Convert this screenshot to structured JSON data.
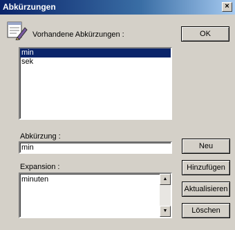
{
  "window": {
    "title": "Abkürzungen",
    "close_glyph": "×"
  },
  "labels": {
    "existing": "Vorhandene Abkürzungen :",
    "abbr": "Abkürzung :",
    "expansion": "Expansion :"
  },
  "list": {
    "items": [
      "min",
      "sek"
    ],
    "selected": "min"
  },
  "abbr_field": {
    "value": "min"
  },
  "expansion_field": {
    "value": "minuten"
  },
  "buttons": {
    "ok": "OK",
    "neu": "Neu",
    "hinzufuegen": "Hinzufügen",
    "aktualisieren": "Aktualisieren",
    "loeschen": "Löschen"
  },
  "scrollbar": {
    "up": "▲",
    "down": "▼"
  }
}
